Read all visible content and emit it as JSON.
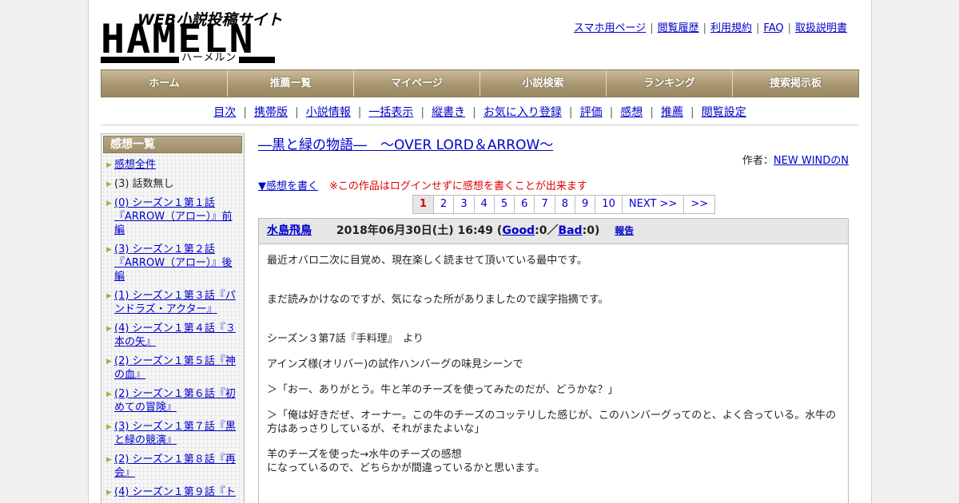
{
  "logo": {
    "sub": "WEB小説投稿サイト",
    "main": "HAMELN",
    "kana": "ハーメルン"
  },
  "top_links": [
    "スマホ用ページ",
    "閲覧履歴",
    "利用規約",
    "FAQ",
    "取扱説明書"
  ],
  "nav": [
    "ホーム",
    "推薦一覧",
    "マイページ",
    "小説検索",
    "ランキング",
    "捜索掲示板"
  ],
  "sub_nav": [
    "目次",
    "携帯版",
    "小説情報",
    "一括表示",
    "縦書き",
    "お気に入り登録",
    "評価",
    "感想",
    "推薦",
    "閲覧設定"
  ],
  "sidebar": {
    "heading": "感想一覧",
    "items": [
      {
        "label": "感想全件",
        "link": true
      },
      {
        "label": "(3) 話数無し",
        "link": false
      },
      {
        "label": "(0) シーズン１第１話『ARROW（アロー）』前編",
        "link": true
      },
      {
        "label": "(3) シーズン１第２話『ARROW（アロー）』後編",
        "link": true
      },
      {
        "label": "(1) シーズン１第３話『パンドラズ・アクター』",
        "link": true
      },
      {
        "label": "(4) シーズン１第４話『３本の矢』",
        "link": true
      },
      {
        "label": "(2) シーズン１第５話『神の血』",
        "link": true
      },
      {
        "label": "(2) シーズン１第６話『初めての冒険』",
        "link": true
      },
      {
        "label": "(3) シーズン１第７話『黒と緑の競演』",
        "link": true
      },
      {
        "label": "(2) シーズン１第８話『再会』",
        "link": true
      },
      {
        "label": "(4) シーズン１第９話『ト",
        "link": true
      }
    ]
  },
  "main": {
    "title": "―黒と緑の物語―　～OVER LORD＆ARROW～",
    "author_label": "作者：",
    "author_name": "NEW WINDのN",
    "write_link": "▼感想を書く",
    "warning": "※この作品はログインせずに感想を書くことが出来ます",
    "pager": [
      "1",
      "2",
      "3",
      "4",
      "5",
      "6",
      "7",
      "8",
      "9",
      "10",
      "NEXT >>",
      ">>"
    ],
    "pager_current": "1"
  },
  "post": {
    "user": "水島飛鳥",
    "date": "2018年06月30日(土) 16:49",
    "good_label": "Good",
    "good_count": "0",
    "bad_label": "Bad",
    "bad_count": "0",
    "report": "報告",
    "paragraphs": [
      "最近オバロ二次に目覚め、現在楽しく読ませて頂いている最中です。",
      "\nまだ読みかけなのですが、気になった所がありましたので誤字指摘です。",
      "\nシーズン３第7話『手料理』　より",
      "アインズ様(オリバー)の試作ハンバーグの味見シーンで",
      "＞「おー、ありがとう。牛と羊のチーズを使ってみたのだが、どうかな？」",
      "＞「俺は好きだぜ、オーナー。この牛のチーズのコッテリした感じが、このハンバーグってのと、よく合っている。水牛の方はあっさりしているが、それがまたよいな」",
      "羊のチーズを使った→水牛のチーズの感想\nになっているので、どちらかが間違っているかと思います。"
    ]
  }
}
